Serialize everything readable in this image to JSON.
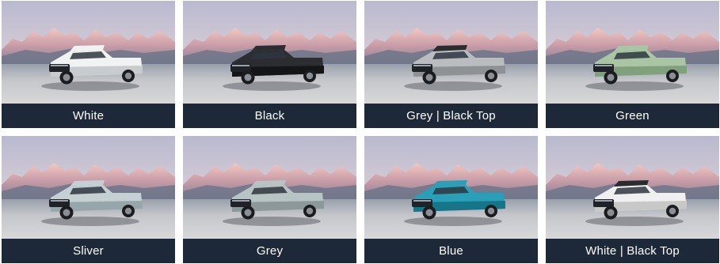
{
  "colors": {
    "label_bg": "#1d2838",
    "label_text": "#ffffff"
  },
  "swatches": [
    {
      "label": "White",
      "body": "#f1f2f2",
      "shade": "#c9cccf",
      "roof": "#f1f2f2"
    },
    {
      "label": "Black",
      "body": "#2b2d30",
      "shade": "#141517",
      "roof": "#2b2d30"
    },
    {
      "label": "Grey | Black Top",
      "body": "#b9bdbf",
      "shade": "#8e9295",
      "roof": "#2a2c2e"
    },
    {
      "label": "Green",
      "body": "#a9c5a3",
      "shade": "#81a07c",
      "roof": "#a9c5a3"
    },
    {
      "label": "Sliver",
      "body": "#c4d0d4",
      "shade": "#97a6ab",
      "roof": "#c4d0d4"
    },
    {
      "label": "Grey",
      "body": "#b8c3c4",
      "shade": "#8c9899",
      "roof": "#b8c3c4"
    },
    {
      "label": "Blue",
      "body": "#2a9fb8",
      "shade": "#17758a",
      "roof": "#2a9fb8"
    },
    {
      "label": "White | Black Top",
      "body": "#f0f0f0",
      "shade": "#c8c8c8",
      "roof": "#2a2c2e"
    }
  ]
}
